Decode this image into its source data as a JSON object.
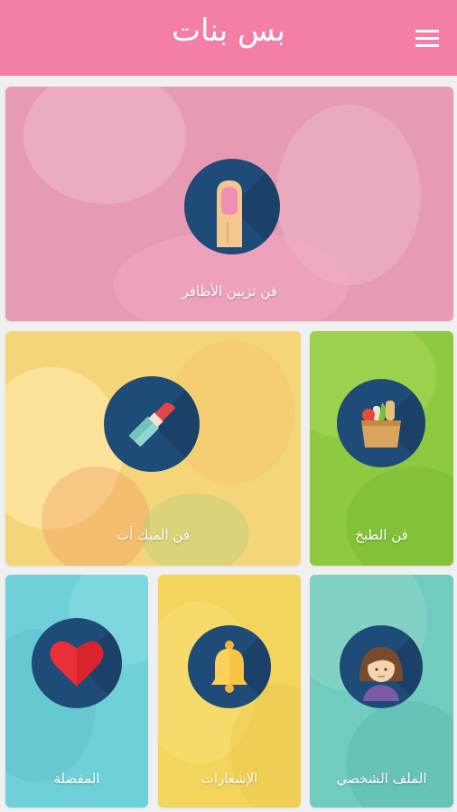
{
  "app": {
    "title": "بس بنات"
  },
  "tiles": {
    "nails": {
      "label": "فن تزيين الأظافر",
      "icon": "nail-icon"
    },
    "makeup": {
      "label": "فن الميك أب",
      "icon": "lipstick-icon"
    },
    "cooking": {
      "label": "فن الطبخ",
      "icon": "grocery-bag-icon"
    },
    "favorites": {
      "label": "المفضلة",
      "icon": "heart-icon"
    },
    "notifications": {
      "label": "الإشعارات",
      "icon": "bell-icon"
    },
    "profile": {
      "label": "الملف الشخصي",
      "icon": "avatar-icon"
    }
  },
  "colors": {
    "appbar": "#f37fa6",
    "circle": "#1f4b78",
    "nails_tile": "#e79ab3",
    "makeup_tile": "#f5d57a",
    "cooking_tile": "#8fc93f",
    "favorites_tile": "#6fd0d9",
    "notifications_tile": "#f3d55e",
    "profile_tile": "#71ccc0"
  }
}
